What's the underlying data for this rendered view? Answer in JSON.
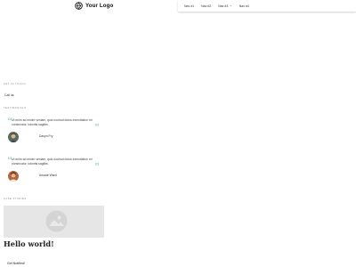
{
  "header": {
    "logo_text": "Your Logo",
    "logo_icon": "logo-mark-icon"
  },
  "nav": {
    "items": [
      {
        "label": "Nav #1"
      },
      {
        "label": "Nav #2"
      },
      {
        "label": "Nav #3",
        "has_dropdown": true
      },
      {
        "label": "Nav #4"
      }
    ]
  },
  "contact": {
    "section_label": "Get in touch",
    "call_us": "Call us:"
  },
  "testimonials": {
    "section_label": "Testimonials",
    "items": [
      {
        "quote": "Ut enim ad minim veniam, quis nostrud dolus exercitation mi consecutor, lobortis sagittis.",
        "author": "Davyn Fry"
      },
      {
        "quote": "Ut enim ad minim veniam, quis nostrud dolus exercitation mi consecutor, lobortis sagittis.",
        "author": "Amadé Ward"
      }
    ]
  },
  "case_studies": {
    "section_label": "Case studies",
    "image_icon": "image-placeholder-icon"
  },
  "post": {
    "title": "Hello world!",
    "cta": "Get Notified!"
  },
  "colors": {
    "accent_quote": "#9fd9c4",
    "placeholder_bg": "#e6e6e6"
  }
}
